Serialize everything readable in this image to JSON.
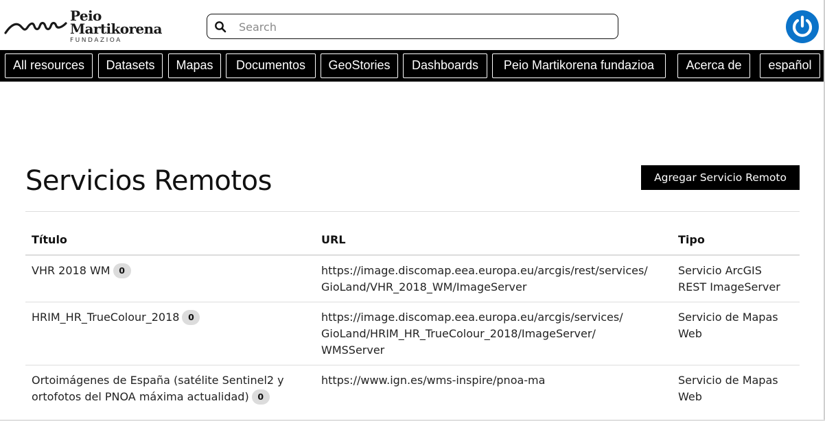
{
  "brand": {
    "line1": "Peio",
    "line2": "Martikorena",
    "line3": "FUNDAZIOA",
    "logo_icon": "signature-wave-icon"
  },
  "search": {
    "placeholder": "Search",
    "value": "",
    "icon": "search-icon"
  },
  "user": {
    "avatar_icon": "power-icon",
    "avatar_color": "#0b73c9"
  },
  "nav": {
    "items": [
      {
        "label": "All resources"
      },
      {
        "label": "Datasets"
      },
      {
        "label": "Mapas"
      },
      {
        "label": "Documentos"
      },
      {
        "label": "GeoStories"
      },
      {
        "label": "Dashboards"
      },
      {
        "label": "Peio Martikorena fundazioa"
      },
      {
        "label": "Acerca de"
      },
      {
        "label": "español"
      }
    ]
  },
  "main": {
    "title": "Servicios Remotos",
    "add_button": "Agregar Servicio Remoto"
  },
  "table": {
    "columns": [
      "Título",
      "URL",
      "Tipo"
    ],
    "rows": [
      {
        "title": "VHR 2018 WM",
        "count": "0",
        "url_lines": [
          "https://image.discomap.eea.europa.eu/arcgis/rest/services/",
          "GioLand/VHR_2018_WM/ImageServer"
        ],
        "type_lines": [
          "Servicio ArcGIS",
          "REST ImageServer"
        ]
      },
      {
        "title": "HRIM_HR_TrueColour_2018",
        "count": "0",
        "url_lines": [
          "https://image.discomap.eea.europa.eu/arcgis/services/",
          "GioLand/HRIM_HR_TrueColour_2018/ImageServer/",
          "WMSServer"
        ],
        "type_lines": [
          "Servicio de Mapas",
          "Web"
        ]
      },
      {
        "title_lines": [
          "Ortoimágenes de España (satélite Sentinel2 y",
          "ortofotos del PNOA máxima actualidad)"
        ],
        "count": "0",
        "url_lines": [
          "https://www.ign.es/wms-inspire/pnoa-ma"
        ],
        "type_lines": [
          "Servicio de Mapas",
          "Web"
        ]
      }
    ]
  }
}
